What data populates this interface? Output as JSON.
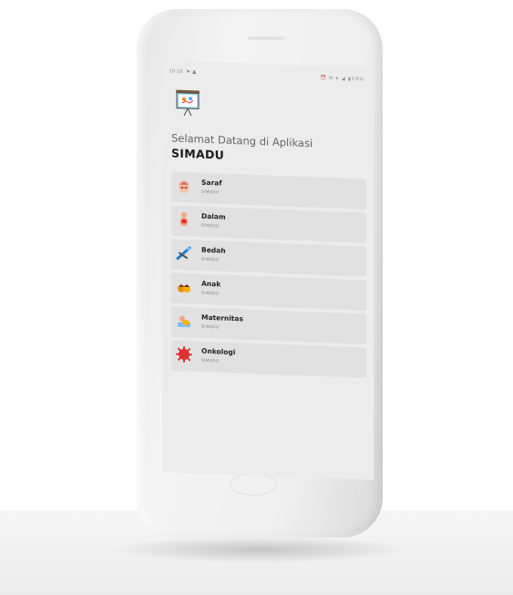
{
  "status_bar": {
    "time": "10:18",
    "icons": "⏰ N ▾ ◢ ▮59%"
  },
  "header": {
    "welcome_text": "Selamat Datang di Aplikasi",
    "app_name": "SIMADU"
  },
  "menu": {
    "items": [
      {
        "title": "Saraf",
        "subtitle": "SIMADU",
        "icon": "brain-anatomy-icon"
      },
      {
        "title": "Dalam",
        "subtitle": "SIMADU",
        "icon": "internal-organs-icon"
      },
      {
        "title": "Bedah",
        "subtitle": "SIMADU",
        "icon": "surgery-tools-icon"
      },
      {
        "title": "Anak",
        "subtitle": "SIMADU",
        "icon": "children-icon"
      },
      {
        "title": "Maternitas",
        "subtitle": "SIMADU",
        "icon": "maternity-icon"
      },
      {
        "title": "Onkologi",
        "subtitle": "SIMADU",
        "icon": "oncology-cell-icon"
      }
    ]
  },
  "colors": {
    "screen_bg": "#ececec",
    "card_bg": "#e1e1e1",
    "oncology_red": "#e03131"
  }
}
